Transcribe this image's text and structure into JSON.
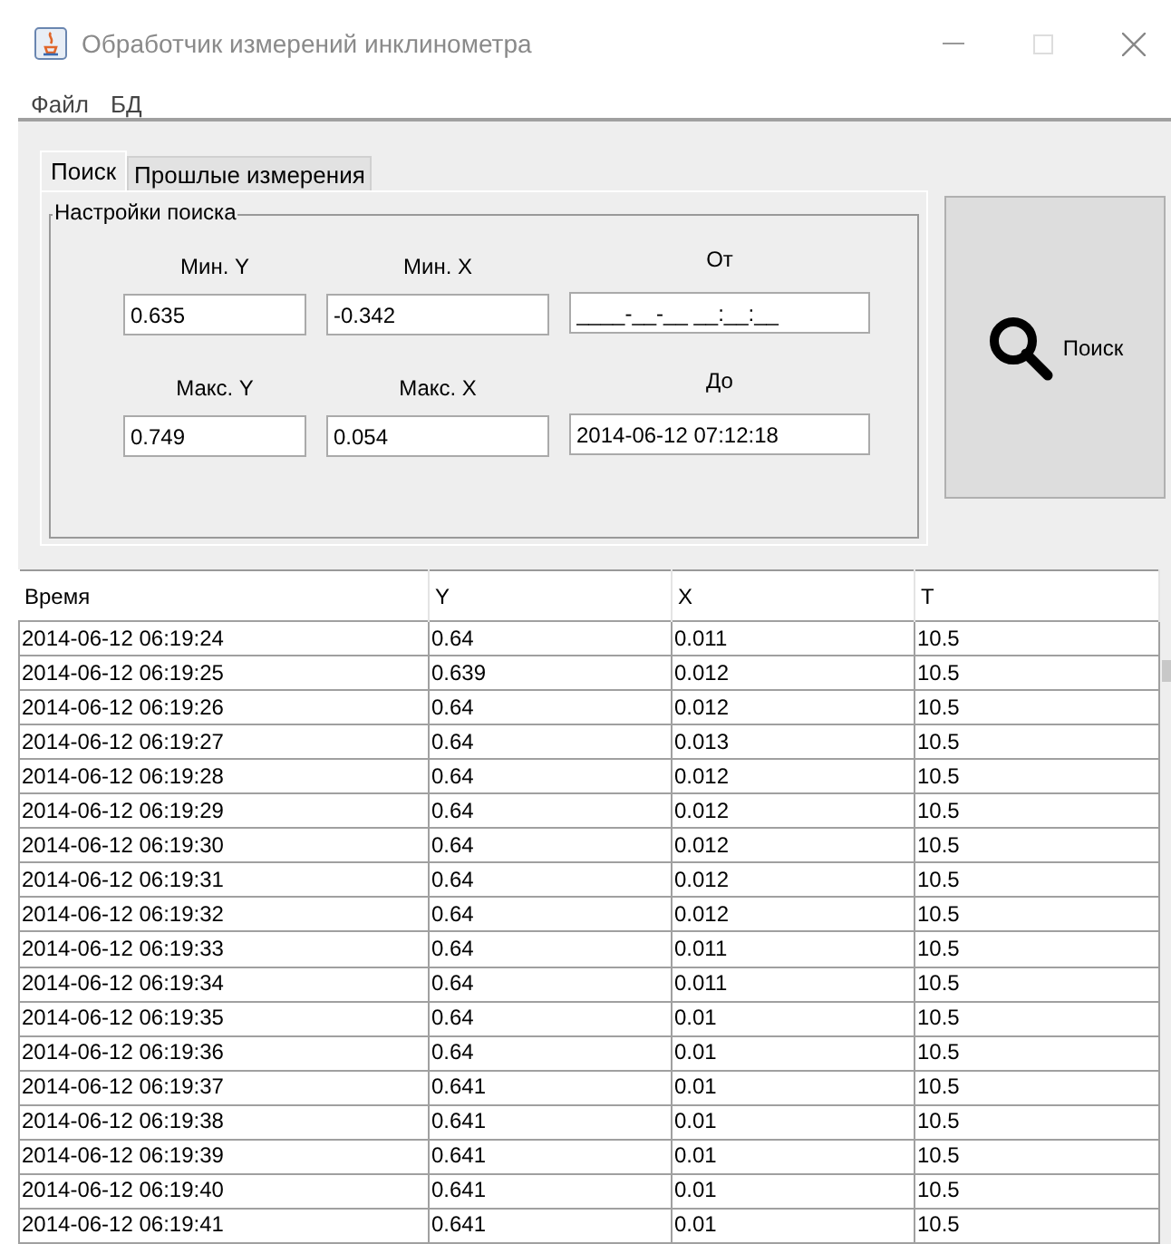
{
  "window": {
    "title": "Обработчик измерений инклинометра"
  },
  "menu": [
    "Файл",
    "БД"
  ],
  "tabs": [
    {
      "label": "Поиск",
      "selected": true
    },
    {
      "label": "Прошлые измерения",
      "selected": false
    }
  ],
  "search_settings": {
    "title": "Настройки поиска",
    "fields": [
      {
        "label": "Мин. Y",
        "value": "0.635"
      },
      {
        "label": "Мин. X",
        "value": "-0.342"
      },
      {
        "label": "От",
        "value": "____-__-__ __:__:__"
      },
      {
        "label": "Макс. Y",
        "value": "0.749"
      },
      {
        "label": "Макс. X",
        "value": "0.054"
      },
      {
        "label": "До",
        "value": "2014-06-12 07:12:18"
      }
    ]
  },
  "search_button": {
    "label": "Поиск"
  },
  "table": {
    "columns": [
      "Время",
      "Y",
      "X",
      "T"
    ],
    "rows": [
      [
        "2014-06-12 06:19:24",
        "0.64",
        "0.011",
        "10.5"
      ],
      [
        "2014-06-12 06:19:25",
        "0.639",
        "0.012",
        "10.5"
      ],
      [
        "2014-06-12 06:19:26",
        "0.64",
        "0.012",
        "10.5"
      ],
      [
        "2014-06-12 06:19:27",
        "0.64",
        "0.013",
        "10.5"
      ],
      [
        "2014-06-12 06:19:28",
        "0.64",
        "0.012",
        "10.5"
      ],
      [
        "2014-06-12 06:19:29",
        "0.64",
        "0.012",
        "10.5"
      ],
      [
        "2014-06-12 06:19:30",
        "0.64",
        "0.012",
        "10.5"
      ],
      [
        "2014-06-12 06:19:31",
        "0.64",
        "0.012",
        "10.5"
      ],
      [
        "2014-06-12 06:19:32",
        "0.64",
        "0.012",
        "10.5"
      ],
      [
        "2014-06-12 06:19:33",
        "0.64",
        "0.011",
        "10.5"
      ],
      [
        "2014-06-12 06:19:34",
        "0.64",
        "0.011",
        "10.5"
      ],
      [
        "2014-06-12 06:19:35",
        "0.64",
        "0.01",
        "10.5"
      ],
      [
        "2014-06-12 06:19:36",
        "0.64",
        "0.01",
        "10.5"
      ],
      [
        "2014-06-12 06:19:37",
        "0.641",
        "0.01",
        "10.5"
      ],
      [
        "2014-06-12 06:19:38",
        "0.641",
        "0.01",
        "10.5"
      ],
      [
        "2014-06-12 06:19:39",
        "0.641",
        "0.01",
        "10.5"
      ],
      [
        "2014-06-12 06:19:40",
        "0.641",
        "0.01",
        "10.5"
      ],
      [
        "2014-06-12 06:19:41",
        "0.641",
        "0.01",
        "10.5"
      ]
    ]
  }
}
